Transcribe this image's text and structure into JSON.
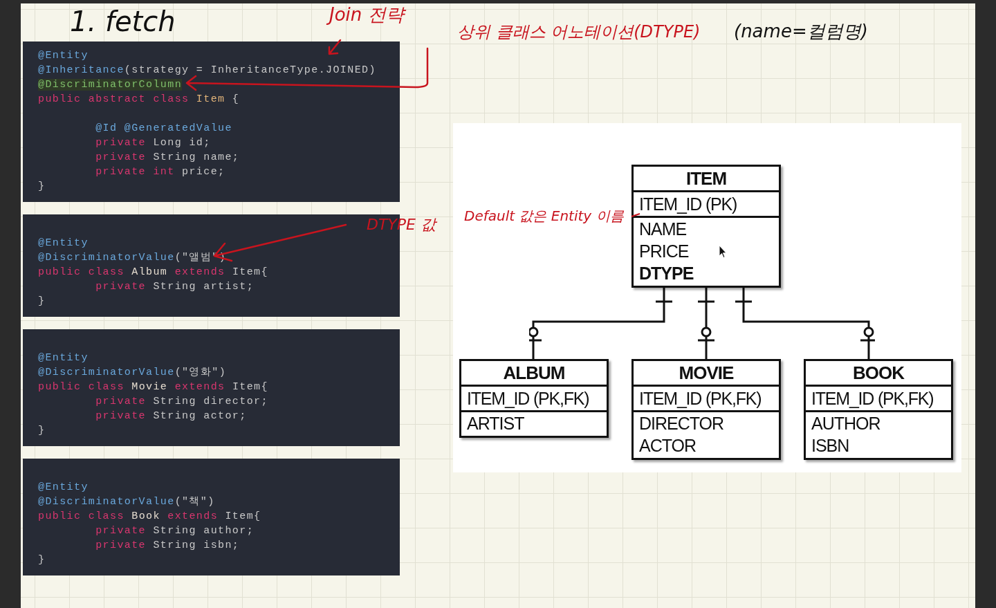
{
  "notes": [
    {
      "text": "1. fetch",
      "color": "#111111"
    },
    {
      "text": "Join 전략",
      "color": "#c8141e"
    },
    {
      "text": "상위 클래스 어노테이션(DTYPE)",
      "color": "#c8141e"
    },
    {
      "text": "(name=컬럼명)",
      "color": "#111111"
    },
    {
      "text": "DTYPE 값",
      "color": "#c8141e"
    },
    {
      "text": "Default 값은 Entity 이름",
      "color": "#c8141e"
    }
  ],
  "code_blocks": [
    {
      "lines": [
        {
          "kind": "code",
          "tokens": [
            {
              "kind": "annotation",
              "text": "@Entity"
            }
          ]
        },
        {
          "kind": "code",
          "tokens": [
            {
              "kind": "annotation",
              "text": "@Inheritance"
            },
            {
              "kind": "plain",
              "text": "(strategy = InheritanceType.JOINED)"
            }
          ]
        },
        {
          "kind": "code",
          "tokens": [
            {
              "kind": "highlight",
              "text": "@DiscriminatorColumn"
            }
          ]
        },
        {
          "kind": "code",
          "tokens": [
            {
              "kind": "keyword",
              "text": "public abstract class "
            },
            {
              "kind": "type",
              "text": "Item"
            },
            {
              "kind": "plain",
              "text": " {"
            }
          ]
        },
        {
          "kind": "blank"
        },
        {
          "kind": "code",
          "tokens": [
            {
              "kind": "annotation",
              "text": "        @Id @GeneratedValue"
            }
          ]
        },
        {
          "kind": "code",
          "tokens": [
            {
              "kind": "keyword",
              "text": "        private "
            },
            {
              "kind": "plain",
              "text": "Long id;"
            }
          ]
        },
        {
          "kind": "code",
          "tokens": [
            {
              "kind": "keyword",
              "text": "        private "
            },
            {
              "kind": "plain",
              "text": "String name;"
            }
          ]
        },
        {
          "kind": "code",
          "tokens": [
            {
              "kind": "keyword",
              "text": "        private int "
            },
            {
              "kind": "plain",
              "text": "price;"
            }
          ]
        },
        {
          "kind": "code",
          "tokens": [
            {
              "kind": "plain",
              "text": "}"
            }
          ]
        }
      ]
    },
    {
      "lines": [
        {
          "kind": "blank"
        },
        {
          "kind": "code",
          "tokens": [
            {
              "kind": "annotation",
              "text": "@Entity"
            }
          ]
        },
        {
          "kind": "code",
          "tokens": [
            {
              "kind": "annotation",
              "text": "@DiscriminatorValue"
            },
            {
              "kind": "plain",
              "text": "(\"앨범\")"
            }
          ]
        },
        {
          "kind": "code",
          "tokens": [
            {
              "kind": "keyword",
              "text": "public class "
            },
            {
              "kind": "name",
              "text": "Album "
            },
            {
              "kind": "keyword",
              "text": "extends "
            },
            {
              "kind": "plain",
              "text": "Item{"
            }
          ]
        },
        {
          "kind": "code",
          "tokens": [
            {
              "kind": "keyword",
              "text": "        private "
            },
            {
              "kind": "plain",
              "text": "String artist;"
            }
          ]
        },
        {
          "kind": "code",
          "tokens": [
            {
              "kind": "plain",
              "text": "}"
            }
          ]
        }
      ]
    },
    {
      "lines": [
        {
          "kind": "blank"
        },
        {
          "kind": "code",
          "tokens": [
            {
              "kind": "annotation",
              "text": "@Entity"
            }
          ]
        },
        {
          "kind": "code",
          "tokens": [
            {
              "kind": "annotation",
              "text": "@DiscriminatorValue"
            },
            {
              "kind": "plain",
              "text": "(\"영화\")"
            }
          ]
        },
        {
          "kind": "code",
          "tokens": [
            {
              "kind": "keyword",
              "text": "public class "
            },
            {
              "kind": "name",
              "text": "Movie "
            },
            {
              "kind": "keyword",
              "text": "extends "
            },
            {
              "kind": "plain",
              "text": "Item{"
            }
          ]
        },
        {
          "kind": "code",
          "tokens": [
            {
              "kind": "keyword",
              "text": "        private "
            },
            {
              "kind": "plain",
              "text": "String director;"
            }
          ]
        },
        {
          "kind": "code",
          "tokens": [
            {
              "kind": "keyword",
              "text": "        private "
            },
            {
              "kind": "plain",
              "text": "String actor;"
            }
          ]
        },
        {
          "kind": "code",
          "tokens": [
            {
              "kind": "plain",
              "text": "}"
            }
          ]
        }
      ]
    },
    {
      "lines": [
        {
          "kind": "blank"
        },
        {
          "kind": "code",
          "tokens": [
            {
              "kind": "annotation",
              "text": "@Entity"
            }
          ]
        },
        {
          "kind": "code",
          "tokens": [
            {
              "kind": "annotation",
              "text": "@DiscriminatorValue"
            },
            {
              "kind": "plain",
              "text": "(\"책\")"
            }
          ]
        },
        {
          "kind": "code",
          "tokens": [
            {
              "kind": "keyword",
              "text": "public class "
            },
            {
              "kind": "name",
              "text": "Book "
            },
            {
              "kind": "keyword",
              "text": "extends "
            },
            {
              "kind": "plain",
              "text": "Item{"
            }
          ]
        },
        {
          "kind": "code",
          "tokens": [
            {
              "kind": "keyword",
              "text": "        private "
            },
            {
              "kind": "plain",
              "text": "String author;"
            }
          ]
        },
        {
          "kind": "code",
          "tokens": [
            {
              "kind": "keyword",
              "text": "        private "
            },
            {
              "kind": "plain",
              "text": "String isbn;"
            }
          ]
        },
        {
          "kind": "code",
          "tokens": [
            {
              "kind": "plain",
              "text": "}"
            }
          ]
        }
      ]
    }
  ],
  "diagram": {
    "tables": [
      {
        "name": "ITEM",
        "key": "ITEM_ID (PK)",
        "columns": [
          {
            "text": "NAME",
            "bold": false
          },
          {
            "text": "PRICE",
            "bold": false
          },
          {
            "text": "DTYPE",
            "bold": true
          }
        ]
      },
      {
        "name": "ALBUM",
        "key": "ITEM_ID (PK,FK)",
        "columns": [
          {
            "text": "ARTIST",
            "bold": false
          }
        ]
      },
      {
        "name": "MOVIE",
        "key": "ITEM_ID (PK,FK)",
        "columns": [
          {
            "text": "DIRECTOR",
            "bold": false
          },
          {
            "text": "ACTOR",
            "bold": false
          }
        ]
      },
      {
        "name": "BOOK",
        "key": "ITEM_ID (PK,FK)",
        "columns": [
          {
            "text": "AUTHOR",
            "bold": false
          },
          {
            "text": "ISBN",
            "bold": false
          }
        ]
      }
    ]
  }
}
